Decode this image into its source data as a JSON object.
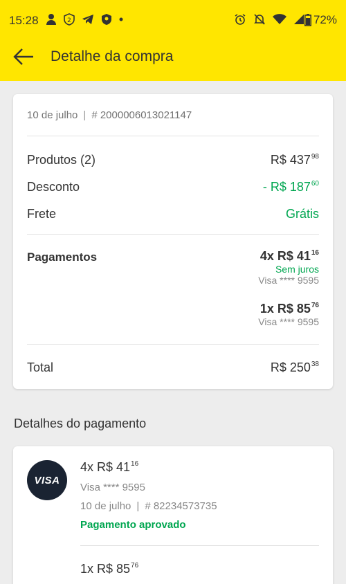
{
  "status_bar": {
    "time": "15:28",
    "battery": "72%",
    "left_icons": [
      "person-icon",
      "shield-2-icon",
      "telegram-icon",
      "badge-icon",
      "dot-icon"
    ],
    "right_icons": [
      "alarm-icon",
      "mute-icon",
      "wifi-icon",
      "signal-icon",
      "battery-icon"
    ]
  },
  "header": {
    "title": "Detalhe da compra",
    "bg_color": "#ffe600"
  },
  "summary": {
    "date": "10 de julho",
    "separator": "|",
    "order_number": "# 200000601302114​7",
    "rows": [
      {
        "label": "Produtos (2)",
        "value_main": "R$ 437",
        "value_cents": "98"
      },
      {
        "label": "Desconto",
        "value_main": "- R$ 187",
        "value_cents": "60"
      },
      {
        "label": "Frete",
        "value_main": "Grátis",
        "value_cents": ""
      }
    ],
    "payments_label": "Pagamentos",
    "payments": [
      {
        "amount_main": "4x R$ 41",
        "amount_cents": "16",
        "note": "Sem juros",
        "card": "Visa **** 9595"
      },
      {
        "amount_main": "1x R$ 85",
        "amount_cents": "76",
        "note": "",
        "card": "Visa **** 9595"
      }
    ],
    "total_label": "Total",
    "total_main": "R$ 250",
    "total_cents": "38"
  },
  "payment_details": {
    "title": "Detalhes do pagamento",
    "logo_text": "VISA",
    "items": [
      {
        "amount_main": "4x R$ 41",
        "amount_cents": "16",
        "card": "Visa **** 9595",
        "date": "10 de julho",
        "separator": "|",
        "ref": "# 82234573735",
        "status": "Pagamento aprovado"
      },
      {
        "amount_main": "1x R$ 85",
        "amount_cents": "76"
      }
    ]
  },
  "colors": {
    "accent_green": "#00a650",
    "brand_yellow": "#ffe600",
    "visa_dark": "#1a2332"
  }
}
